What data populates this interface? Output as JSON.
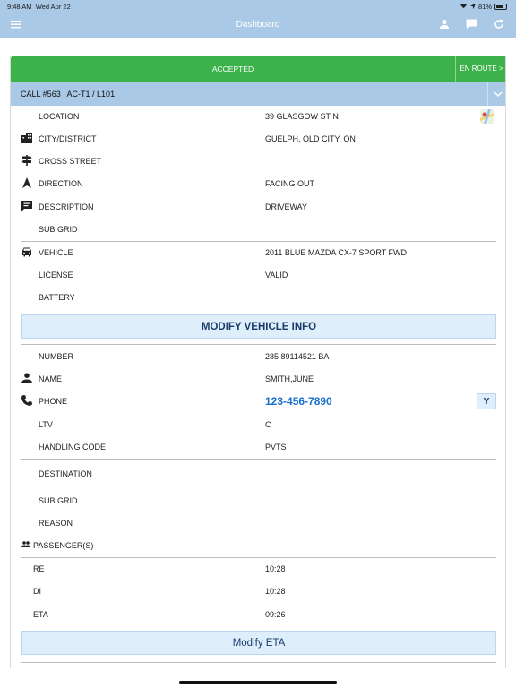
{
  "status_bar": {
    "time": "9:48 AM",
    "date": "Wed Apr 22",
    "battery": "81%",
    "battery_level": 0.81
  },
  "nav": {
    "title": "Dashboard",
    "menu_icon": "hamburger-icon",
    "user_icon": "person-icon",
    "chat_icon": "chat-icon",
    "refresh_icon": "refresh-icon"
  },
  "call": {
    "status": "ACCEPTED",
    "next_status": "EN ROUTE >",
    "header": "CALL #563 | AC-T1 / L101"
  },
  "location_section": {
    "location_label": "LOCATION",
    "location_value": "39 GLASGOW ST N",
    "city_label": "CITY/DISTRICT",
    "city_value": "GUELPH, OLD CITY, ON",
    "cross_label": "CROSS STREET",
    "cross_value": "",
    "direction_label": "DIRECTION",
    "direction_value": "FACING OUT",
    "description_label": "DESCRIPTION",
    "description_value": "DRIVEWAY",
    "subgrid_label": "SUB GRID",
    "subgrid_value": ""
  },
  "vehicle_section": {
    "vehicle_label": "VEHICLE",
    "vehicle_value": "2011 BLUE MAZDA CX-7 SPORT FWD",
    "license_label": "LICENSE",
    "license_value": "VALID",
    "battery_label": "BATTERY",
    "battery_value": "",
    "modify_button": "MODIFY VEHICLE INFO"
  },
  "member_section": {
    "number_label": "NUMBER",
    "number_value": "285 89114521 BA",
    "name_label": "NAME",
    "name_value": "SMITH,JUNE",
    "phone_label": "PHONE",
    "phone_value": "123-456-7890",
    "phone_flag": "Y",
    "ltv_label": "LTV",
    "ltv_value": "C",
    "handling_label": "HANDLING CODE",
    "handling_value": "PVTS"
  },
  "destination_section": {
    "destination_label": "DESTINATION",
    "subgrid_label": "SUB GRID",
    "reason_label": "REASON",
    "passengers_label": "PASSENGER(S)"
  },
  "times": {
    "re_label": "RE",
    "re_value": "10:28",
    "di_label": "DI",
    "di_value": "10:28",
    "eta_label": "ETA",
    "eta_value": "09:26",
    "modify_eta_button": "Modify ETA"
  },
  "colors": {
    "accent": "#a9c9e6",
    "accepted": "#3db24a",
    "button_bg": "#deeefa",
    "link": "#1a6fd0"
  }
}
